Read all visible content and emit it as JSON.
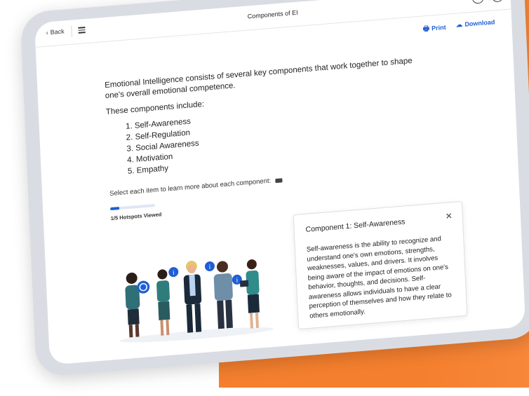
{
  "window": {
    "title": "Components of EI",
    "back_label": "Back"
  },
  "toolbar": {
    "print_label": "Print",
    "download_label": "Download"
  },
  "content": {
    "intro": "Emotional Intelligence consists of several key components that work together to shape one's overall emotional competence.",
    "components_lead": "These components include:",
    "components": [
      "Self-Awareness",
      "Self-Regulation",
      "Social Awareness",
      "Motivation",
      "Empathy"
    ],
    "select_hint": "Select each item to learn more about each component:"
  },
  "progress": {
    "viewed": 1,
    "total": 5,
    "label": "1/5 Hotspots Viewed"
  },
  "popup": {
    "title": "Component 1: Self-Awareness",
    "body": "Self-awareness is the ability to recognize and understand one's own emotions, strengths, weaknesses, values, and drivers. It involves being aware of the impact of emotions on one's behavior, thoughts, and decisions. Self-awareness allows individuals to have a clear perception of themselves and how they relate to others emotionally."
  },
  "colors": {
    "accent": "#1f5fd6",
    "brand_orange": "#f47f2e"
  },
  "icons": {
    "back": "chevron-left-icon",
    "menu": "hamburger-menu-icon",
    "prev": "chevron-left-circle-icon",
    "next": "chevron-right-circle-icon",
    "print": "printer-icon",
    "download": "cloud-download-icon",
    "hint": "keyboard-icon",
    "close": "close-icon",
    "hotspot": "info-icon"
  }
}
